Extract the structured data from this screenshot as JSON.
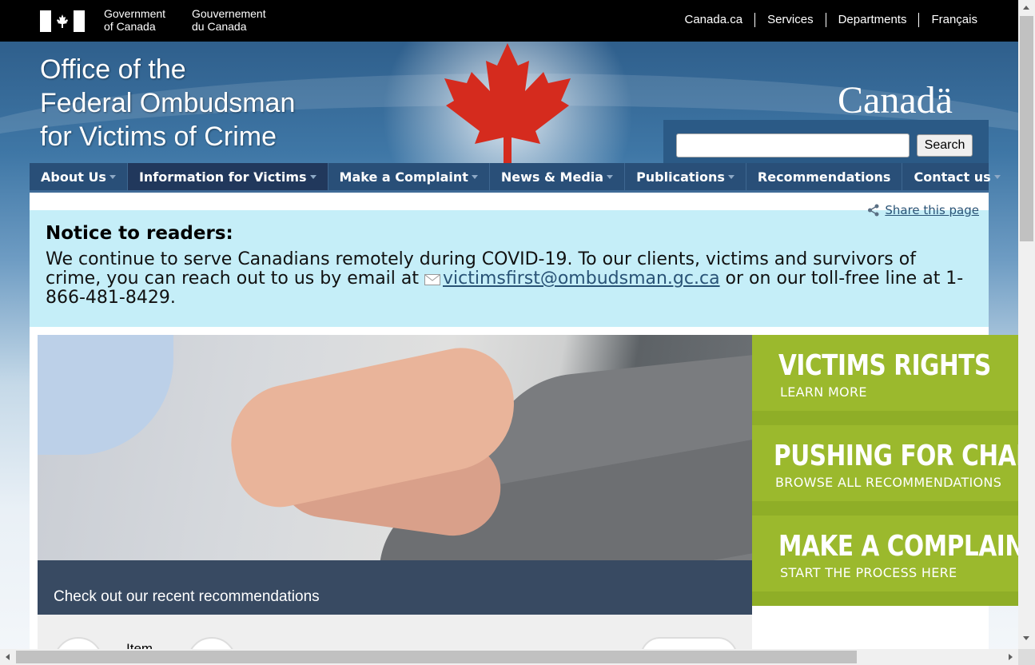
{
  "gov_header": {
    "gov_en": "Government\nof Canada",
    "gov_fr": "Gouvernement\ndu Canada",
    "links": [
      "Canada.ca",
      "Services",
      "Departments",
      "Français"
    ]
  },
  "banner": {
    "title_line1": "Office of the",
    "title_line2": "Federal Ombudsman",
    "title_line3": "for Victims of Crime",
    "wordmark": "Canadä",
    "search_button": "Search",
    "search_placeholder": ""
  },
  "nav": {
    "items": [
      {
        "label": "About Us",
        "caret": true
      },
      {
        "label": "Information for Victims",
        "caret": true,
        "active": true
      },
      {
        "label": "Make a Complaint",
        "caret": true
      },
      {
        "label": "News & Media",
        "caret": true
      },
      {
        "label": "Publications",
        "caret": true
      },
      {
        "label": "Recommendations",
        "caret": false
      },
      {
        "label": "Contact us",
        "caret": true
      }
    ]
  },
  "share": {
    "label": "Share this page"
  },
  "notice": {
    "title": "Notice to readers:",
    "body_before": "We continue to serve Canadians remotely during COVID-19. To our clients, victims and survivors of crime, you can reach out to us by email at ",
    "email": "victimsfirst@ombudsman.gc.ca",
    "body_after": " or on our toll-free line at 1-866-481-8429."
  },
  "carousel": {
    "caption": "Check out our recent recommendations",
    "item_text": "Item"
  },
  "tiles": [
    {
      "title": "VICTIMS RIGHTS",
      "subtitle": "LEARN MORE"
    },
    {
      "title": "PUSHING FOR CHANGE",
      "subtitle": "BROWSE ALL RECOMMENDATIONS"
    },
    {
      "title": "MAKE A COMPLAINT",
      "subtitle": "START THE PROCESS HERE"
    }
  ],
  "colors": {
    "gov_bar": "#000000",
    "nav_bg": "#294f78",
    "notice_bg": "#c5eef8",
    "tile_green": "#9bb92d",
    "maple_red": "#d52b1e"
  }
}
